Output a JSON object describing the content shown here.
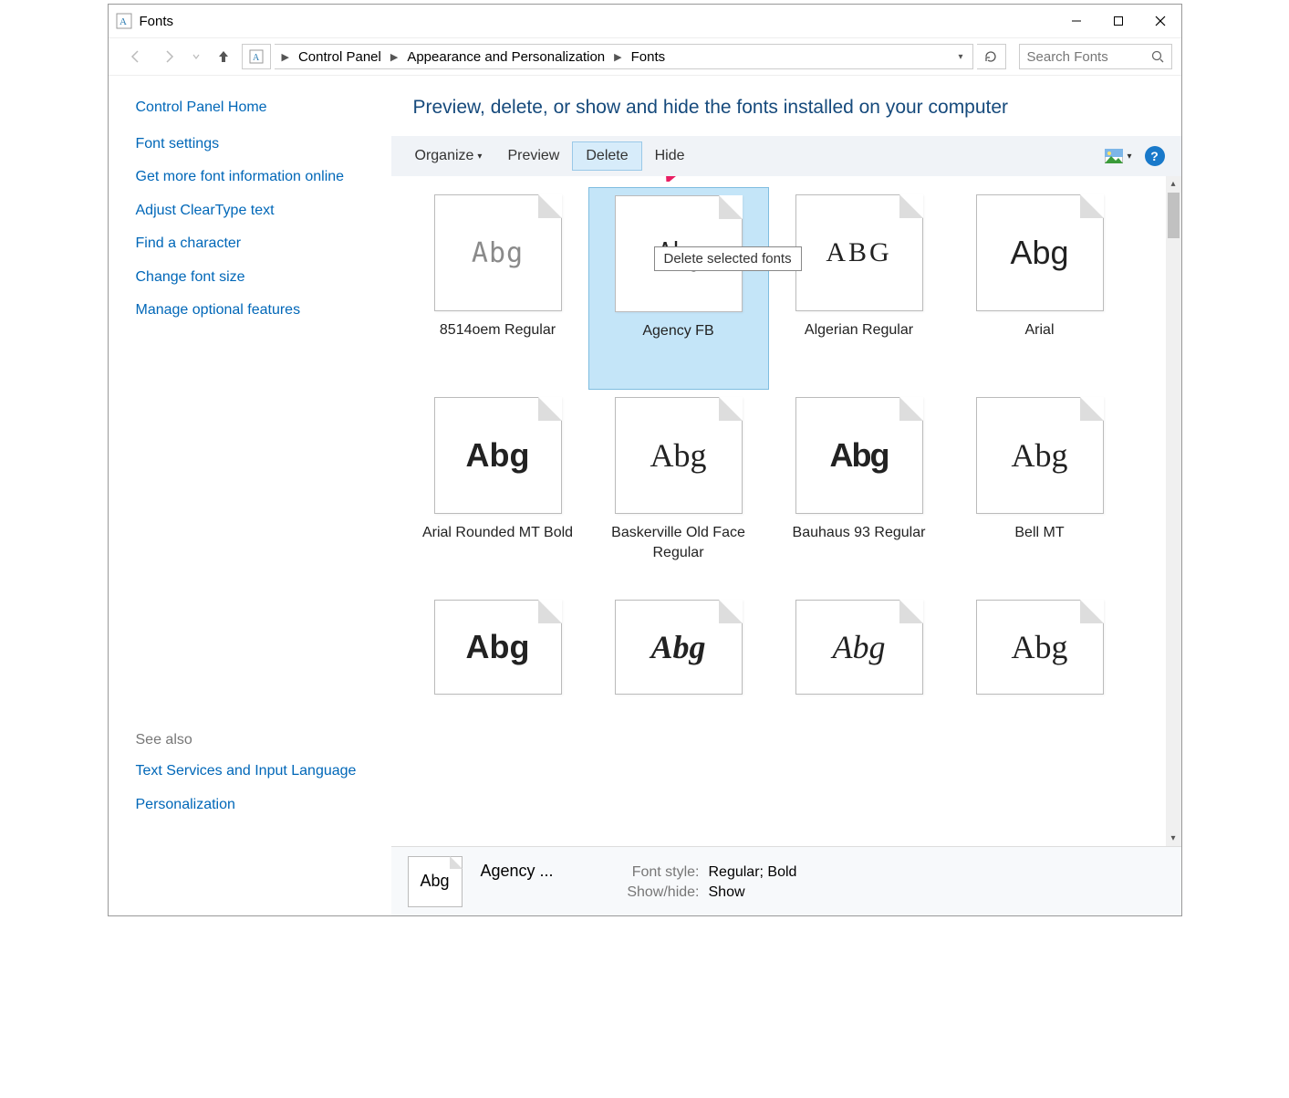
{
  "title": "Fonts",
  "breadcrumbs": {
    "items": [
      "Control Panel",
      "Appearance and Personalization",
      "Fonts"
    ]
  },
  "search": {
    "placeholder": "Search Fonts"
  },
  "sidebar": {
    "home": "Control Panel Home",
    "links": [
      "Font settings",
      "Get more font information online",
      "Adjust ClearType text",
      "Find a character",
      "Change font size",
      "Manage optional features"
    ],
    "see_also_label": "See also",
    "see_also": [
      "Text Services and Input Language",
      "Personalization"
    ]
  },
  "main": {
    "heading": "Preview, delete, or show and hide the fonts installed on your computer"
  },
  "toolbar": {
    "organize": "Organize",
    "preview": "Preview",
    "delete": "Delete",
    "hide": "Hide"
  },
  "tooltip": "Delete selected fonts",
  "fonts": [
    {
      "label": "8514oem Regular",
      "sample": "Abg",
      "style": "raster",
      "stack": false
    },
    {
      "label": "Agency FB",
      "sample": "Abg",
      "style": "narrow",
      "stack": true,
      "selected": true
    },
    {
      "label": "Algerian Regular",
      "sample": "ABG",
      "style": "fancy",
      "stack": false
    },
    {
      "label": "Arial",
      "sample": "Abg",
      "style": "",
      "stack": true
    },
    {
      "label": "Arial Rounded MT Bold",
      "sample": "Abg",
      "style": "rounded",
      "stack": false
    },
    {
      "label": "Baskerville Old Face Regular",
      "sample": "Abg",
      "style": "serif",
      "stack": false
    },
    {
      "label": "Bauhaus 93 Regular",
      "sample": "Abg",
      "style": "bh",
      "stack": false
    },
    {
      "label": "Bell MT",
      "sample": "Abg",
      "style": "serif",
      "stack": true
    },
    {
      "label": "",
      "sample": "Abg",
      "style": "bold2",
      "stack": true,
      "partial": true
    },
    {
      "label": "",
      "sample": "Abg",
      "style": "serif2",
      "stack": false,
      "partial": true
    },
    {
      "label": "",
      "sample": "Abg",
      "style": "script",
      "stack": false,
      "partial": true
    },
    {
      "label": "",
      "sample": "Abg",
      "style": "serif",
      "stack": true,
      "partial": true
    }
  ],
  "footer": {
    "thumb_sample": "Abg",
    "name": "Agency ...",
    "fields": {
      "font_style_label": "Font style:",
      "font_style_value": "Regular; Bold",
      "show_hide_label": "Show/hide:",
      "show_hide_value": "Show"
    }
  }
}
